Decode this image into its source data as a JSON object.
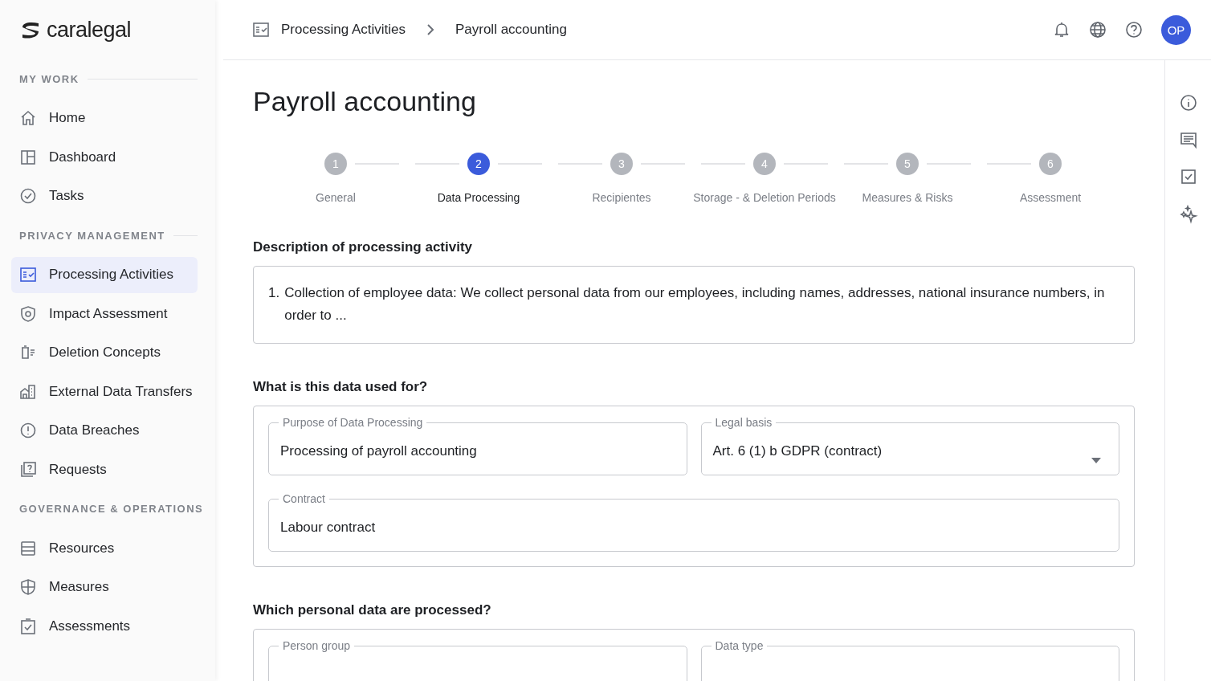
{
  "sidebar": {
    "logo": "caralegal",
    "sections": [
      {
        "title": "MY WORK",
        "items": [
          {
            "label": "Home",
            "selected": false
          },
          {
            "label": "Dashboard",
            "selected": false
          },
          {
            "label": "Tasks",
            "selected": false
          }
        ]
      },
      {
        "title": "PRIVACY MANAGEMENT",
        "items": [
          {
            "label": "Processing Activities",
            "selected": true
          },
          {
            "label": "Impact Assessment",
            "selected": false
          },
          {
            "label": "Deletion Concepts",
            "selected": false
          },
          {
            "label": "External Data Transfers",
            "selected": false
          },
          {
            "label": "Data Breaches",
            "selected": false
          },
          {
            "label": "Requests",
            "selected": false
          }
        ]
      },
      {
        "title": "GOVERNANCE & OPERATIONS",
        "items": [
          {
            "label": "Resources",
            "selected": false
          },
          {
            "label": "Measures",
            "selected": false
          },
          {
            "label": "Assessments",
            "selected": false
          }
        ]
      }
    ]
  },
  "breadcrumb": [
    "Processing Activities",
    "Payroll accounting"
  ],
  "user": {
    "initials": "OP"
  },
  "page_title": "Payroll accounting",
  "steps": [
    {
      "number": "1",
      "label": "General",
      "selected": false
    },
    {
      "number": "2",
      "label": "Data Processing",
      "selected": true
    },
    {
      "number": "3",
      "label": "Recipientes",
      "selected": false
    },
    {
      "number": "4",
      "label": "Storage - & Deletion Periods",
      "selected": false
    },
    {
      "number": "5",
      "label": "Measures  & Risks",
      "selected": false
    },
    {
      "number": "6",
      "label": "Assessment",
      "selected": false
    }
  ],
  "sections": [
    {
      "title": "Description of processing activity",
      "kind": "text",
      "number": "1.",
      "text": "Collection of employee data: We collect personal data from our employees, including names, addresses, national insurance numbers, in order to ..."
    },
    {
      "title": "What is this data used for?",
      "kind": "fields",
      "rows": [
        [
          {
            "label": "Purpose of Data Processing",
            "value": "Processing of payroll accounting",
            "kind": "text"
          },
          {
            "label": "Legal basis",
            "value": "Art. 6 (1) b GDPR (contract)",
            "kind": "select"
          }
        ],
        [
          {
            "label": "Contract",
            "value": "Labour contract",
            "kind": "text"
          }
        ]
      ]
    },
    {
      "title": "Which personal data are processed?",
      "kind": "fields",
      "rows": [
        [
          {
            "label": "Person group",
            "kind": "text"
          },
          {
            "label": "Data type",
            "kind": "text"
          }
        ]
      ]
    }
  ]
}
